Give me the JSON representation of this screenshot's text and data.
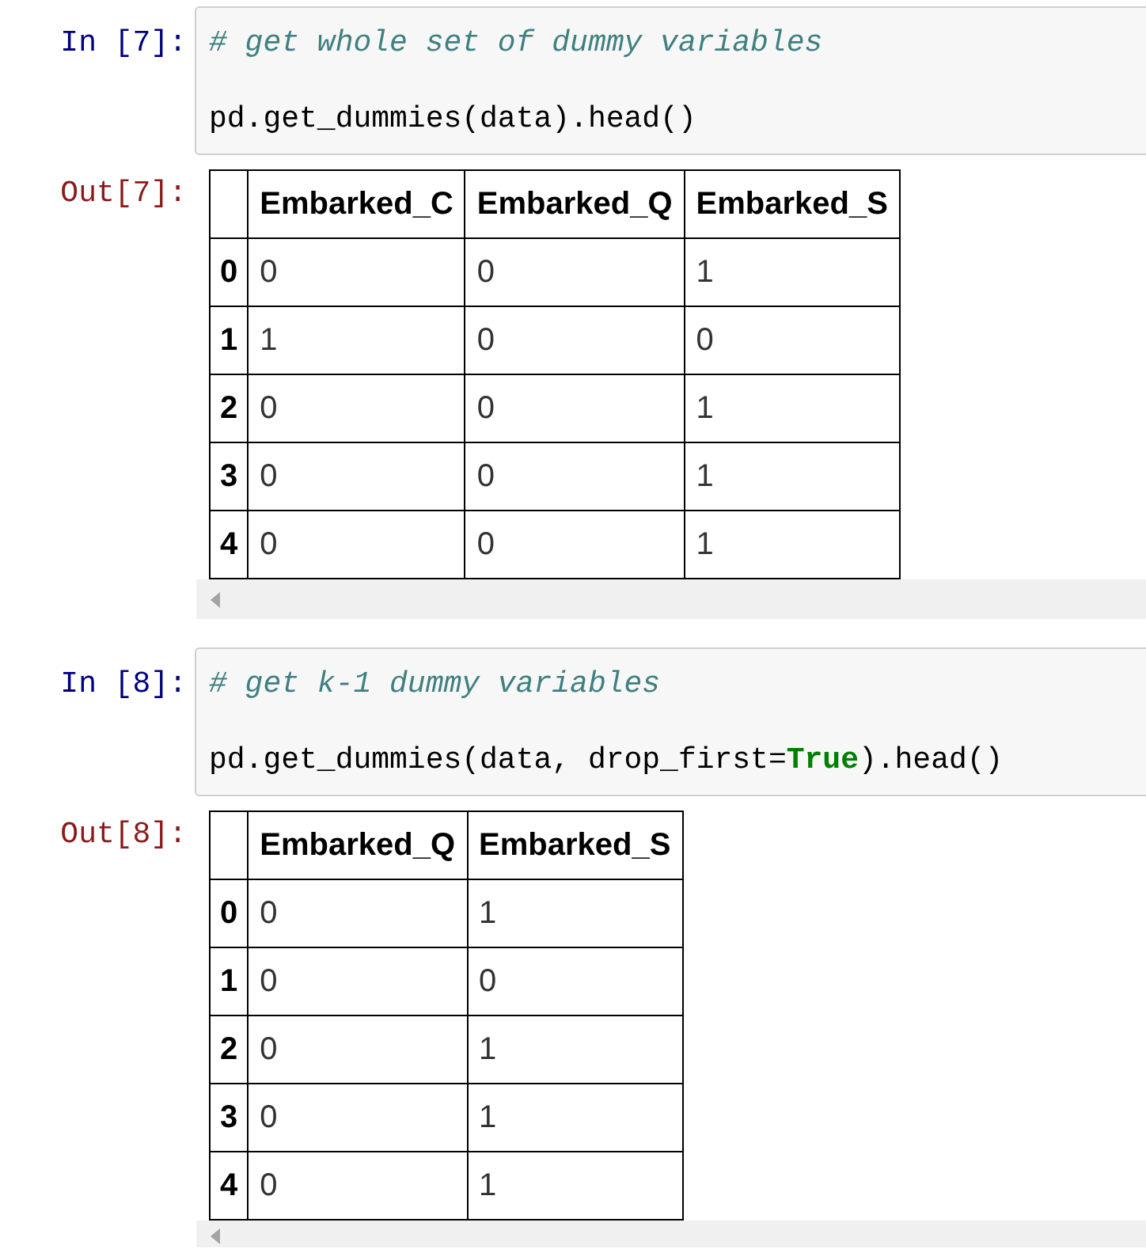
{
  "cells": [
    {
      "input": {
        "prompt": "In [7]:",
        "lines": [
          [
            {
              "kind": "comment",
              "text": "# get whole set of dummy variables"
            }
          ],
          [
            {
              "kind": "plain",
              "text": "pd.get_dummies(data).head()"
            }
          ]
        ]
      },
      "output": {
        "prompt": "Out[7]:",
        "table": {
          "columns": [
            "Embarked_C",
            "Embarked_Q",
            "Embarked_S"
          ],
          "rows": [
            {
              "index": "0",
              "values": [
                "0",
                "0",
                "1"
              ]
            },
            {
              "index": "1",
              "values": [
                "1",
                "0",
                "0"
              ]
            },
            {
              "index": "2",
              "values": [
                "0",
                "0",
                "1"
              ]
            },
            {
              "index": "3",
              "values": [
                "0",
                "0",
                "1"
              ]
            },
            {
              "index": "4",
              "values": [
                "0",
                "0",
                "1"
              ]
            }
          ]
        }
      }
    },
    {
      "input": {
        "prompt": "In [8]:",
        "lines": [
          [
            {
              "kind": "comment",
              "text": "# get k-1 dummy variables"
            }
          ],
          [
            {
              "kind": "plain",
              "text": "pd.get_dummies(data, drop_first="
            },
            {
              "kind": "keyword",
              "text": "True"
            },
            {
              "kind": "plain",
              "text": ").head()"
            }
          ]
        ]
      },
      "output": {
        "prompt": "Out[8]:",
        "table": {
          "columns": [
            "Embarked_Q",
            "Embarked_S"
          ],
          "rows": [
            {
              "index": "0",
              "values": [
                "0",
                "1"
              ]
            },
            {
              "index": "1",
              "values": [
                "0",
                "0"
              ]
            },
            {
              "index": "2",
              "values": [
                "0",
                "1"
              ]
            },
            {
              "index": "3",
              "values": [
                "0",
                "1"
              ]
            },
            {
              "index": "4",
              "values": [
                "0",
                "1"
              ]
            }
          ]
        }
      }
    }
  ]
}
